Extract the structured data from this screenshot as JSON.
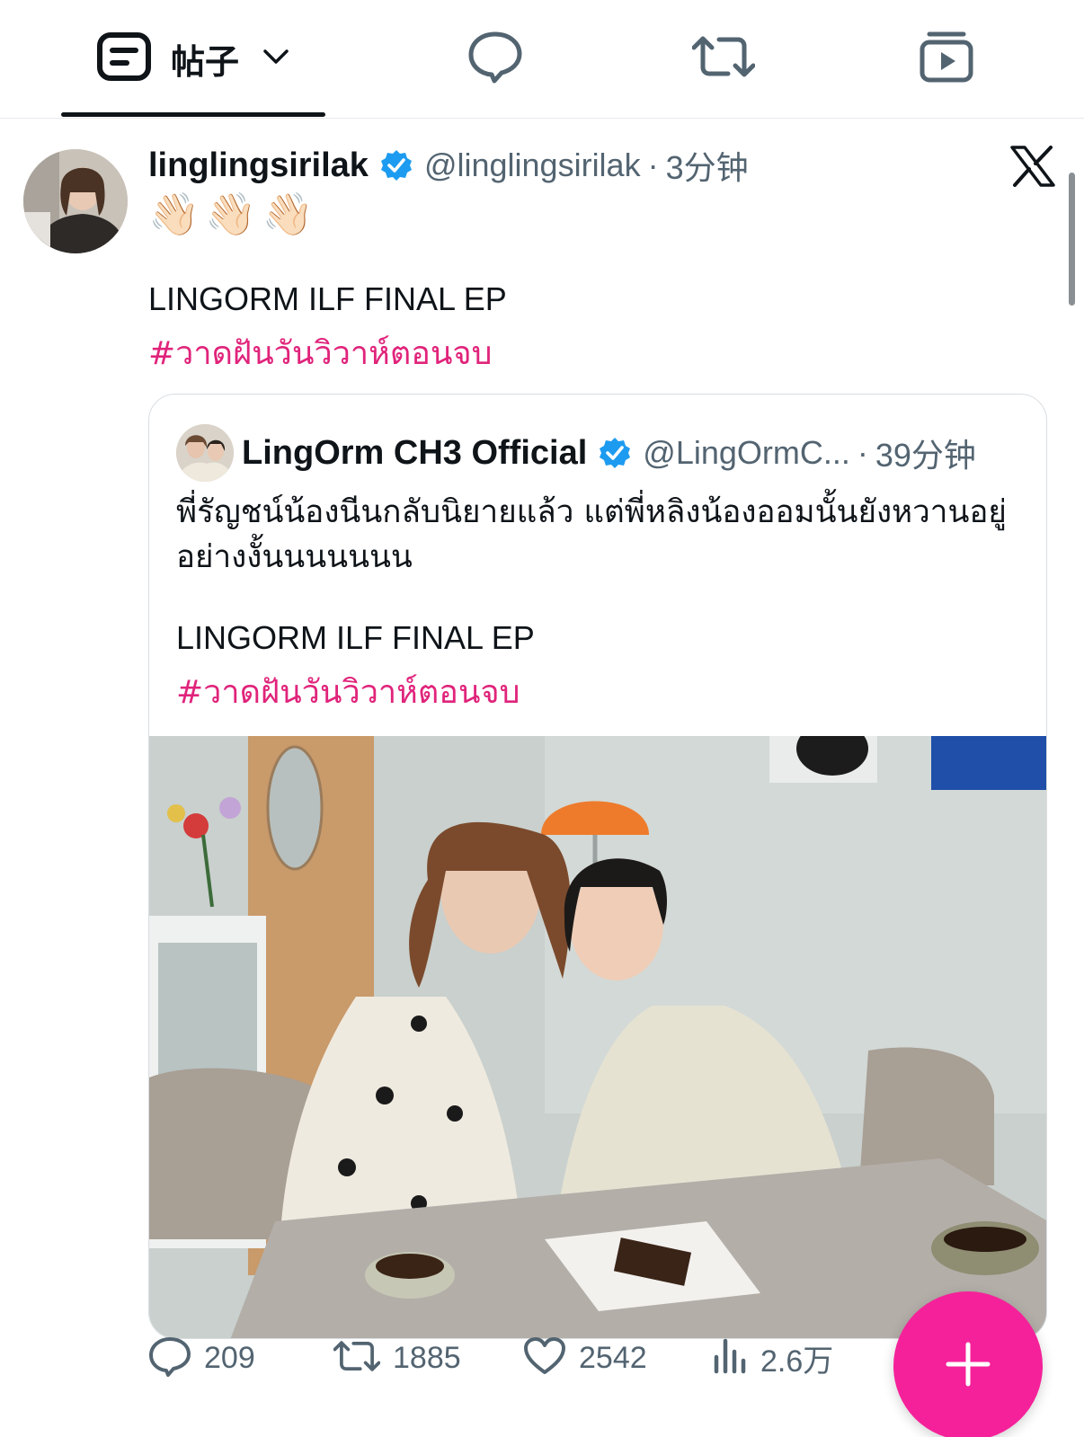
{
  "tabs": {
    "posts_label": "帖子",
    "icons": [
      "post-icon",
      "chevron-down-icon",
      "reply-icon",
      "repost-icon",
      "media-icon"
    ]
  },
  "post": {
    "display_name": "linglingsirilak",
    "handle": "@linglingsirilak",
    "separator": "·",
    "time": "3分钟",
    "emojis": [
      "👋🏻",
      "👋🏻",
      "👋🏻"
    ],
    "text": "LINGORM ILF FINAL EP",
    "hashtag": "#วาดฝันวันวิวาห์ตอนจบ",
    "platform_icon": "x-logo-icon"
  },
  "quote": {
    "display_name": "LingOrm CH3 Official",
    "handle": "@LingOrmC...",
    "separator": "·",
    "time": "39分钟",
    "text_thai": "พี่รัญชน์น้องนีนกลับนิยายแล้ว แต่พี่หลิงน้องออมนั้นยังหวานอยู่อย่างงั้นนนนนนน",
    "text": "LINGORM ILF FINAL EP",
    "hashtag": "#วาดฝันวันวิวาห์ตอนจบ"
  },
  "actions": {
    "replies": "209",
    "reposts": "1885",
    "likes": "2542",
    "views": "2.6万"
  },
  "colors": {
    "accent_pink": "#f5219a",
    "hashtag": "#e0247b",
    "verified_blue": "#1d9bf0",
    "muted_text": "#536471"
  }
}
